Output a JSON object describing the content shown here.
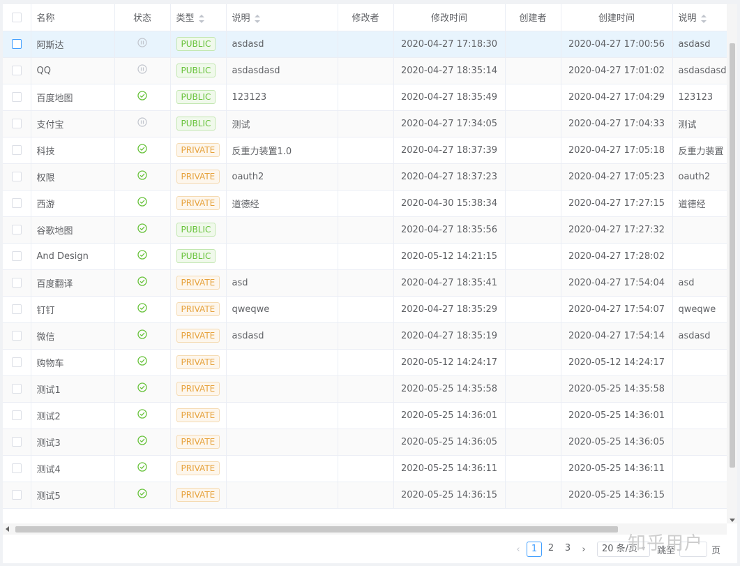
{
  "columns": {
    "name": "名称",
    "status": "状态",
    "type": "类型",
    "desc": "说明",
    "modifier": "修改者",
    "modified_time": "修改时间",
    "creator": "创建者",
    "created_time": "创建时间",
    "desc2": "说明"
  },
  "rows": [
    {
      "name": "阿斯达",
      "status": "disabled",
      "type": "PUBLIC",
      "desc": "asdasd",
      "modifier": "",
      "modified": "2020-04-27 17:18:30",
      "creator": "",
      "created": "2020-04-27 17:00:56",
      "desc2": "asdasd"
    },
    {
      "name": "QQ",
      "status": "disabled",
      "type": "PUBLIC",
      "desc": "asdasdasd",
      "modifier": "",
      "modified": "2020-04-27 18:35:14",
      "creator": "",
      "created": "2020-04-27 17:01:02",
      "desc2": "asdasdasd"
    },
    {
      "name": "百度地图",
      "status": "enabled",
      "type": "PUBLIC",
      "desc": "123123",
      "modifier": "",
      "modified": "2020-04-27 18:35:49",
      "creator": "",
      "created": "2020-04-27 17:04:29",
      "desc2": "123123"
    },
    {
      "name": "支付宝",
      "status": "disabled",
      "type": "PUBLIC",
      "desc": "测试",
      "modifier": "",
      "modified": "2020-04-27 17:34:05",
      "creator": "",
      "created": "2020-04-27 17:04:33",
      "desc2": "测试"
    },
    {
      "name": "科技",
      "status": "enabled",
      "type": "PRIVATE",
      "desc": "反重力装置1.0",
      "modifier": "",
      "modified": "2020-04-27 18:37:39",
      "creator": "",
      "created": "2020-04-27 17:05:18",
      "desc2": "反重力装置"
    },
    {
      "name": "权限",
      "status": "enabled",
      "type": "PRIVATE",
      "desc": "oauth2",
      "modifier": "",
      "modified": "2020-04-27 18:37:23",
      "creator": "",
      "created": "2020-04-27 17:05:23",
      "desc2": "oauth2"
    },
    {
      "name": "西游",
      "status": "enabled",
      "type": "PRIVATE",
      "desc": "道德经",
      "modifier": "",
      "modified": "2020-04-30 15:38:34",
      "creator": "",
      "created": "2020-04-27 17:27:15",
      "desc2": "道德经"
    },
    {
      "name": "谷歌地图",
      "status": "enabled",
      "type": "PUBLIC",
      "desc": "",
      "modifier": "",
      "modified": "2020-04-27 18:35:56",
      "creator": "",
      "created": "2020-04-27 17:27:32",
      "desc2": ""
    },
    {
      "name": "And Design",
      "status": "enabled",
      "type": "PUBLIC",
      "desc": "",
      "modifier": "",
      "modified": "2020-05-12 14:21:15",
      "creator": "",
      "created": "2020-04-27 17:28:02",
      "desc2": ""
    },
    {
      "name": "百度翻译",
      "status": "enabled",
      "type": "PRIVATE",
      "desc": "asd",
      "modifier": "",
      "modified": "2020-04-27 18:35:41",
      "creator": "",
      "created": "2020-04-27 17:54:04",
      "desc2": "asd"
    },
    {
      "name": "钉钉",
      "status": "enabled",
      "type": "PRIVATE",
      "desc": "qweqwe",
      "modifier": "",
      "modified": "2020-04-27 18:35:29",
      "creator": "",
      "created": "2020-04-27 17:54:07",
      "desc2": "qweqwe"
    },
    {
      "name": "微信",
      "status": "enabled",
      "type": "PRIVATE",
      "desc": "asdasd",
      "modifier": "",
      "modified": "2020-04-27 18:35:19",
      "creator": "",
      "created": "2020-04-27 17:54:14",
      "desc2": "asdasd"
    },
    {
      "name": "购物车",
      "status": "enabled",
      "type": "PRIVATE",
      "desc": "",
      "modifier": "",
      "modified": "2020-05-12 14:24:17",
      "creator": "",
      "created": "2020-05-12 14:24:17",
      "desc2": ""
    },
    {
      "name": "测试1",
      "status": "enabled",
      "type": "PRIVATE",
      "desc": "",
      "modifier": "",
      "modified": "2020-05-25 14:35:58",
      "creator": "",
      "created": "2020-05-25 14:35:58",
      "desc2": ""
    },
    {
      "name": "测试2",
      "status": "enabled",
      "type": "PRIVATE",
      "desc": "",
      "modifier": "",
      "modified": "2020-05-25 14:36:01",
      "creator": "",
      "created": "2020-05-25 14:36:01",
      "desc2": ""
    },
    {
      "name": "测试3",
      "status": "enabled",
      "type": "PRIVATE",
      "desc": "",
      "modifier": "",
      "modified": "2020-05-25 14:36:05",
      "creator": "",
      "created": "2020-05-25 14:36:05",
      "desc2": ""
    },
    {
      "name": "测试4",
      "status": "enabled",
      "type": "PRIVATE",
      "desc": "",
      "modifier": "",
      "modified": "2020-05-25 14:36:11",
      "creator": "",
      "created": "2020-05-25 14:36:11",
      "desc2": ""
    },
    {
      "name": "测试5",
      "status": "enabled",
      "type": "PRIVATE",
      "desc": "",
      "modifier": "",
      "modified": "2020-05-25 14:36:15",
      "creator": "",
      "created": "2020-05-25 14:36:15",
      "desc2": ""
    }
  ],
  "pagination": {
    "pages": [
      "1",
      "2",
      "3"
    ],
    "current": "1",
    "page_size": "20 条/页",
    "jump_label": "跳至",
    "page_suffix": "页"
  },
  "colors": {
    "public": "#67c23a",
    "private": "#e6a23c",
    "enabled_icon": "#67c23a",
    "disabled_icon": "#c0c4cc",
    "accent": "#409eff"
  },
  "watermark": "知乎用户"
}
